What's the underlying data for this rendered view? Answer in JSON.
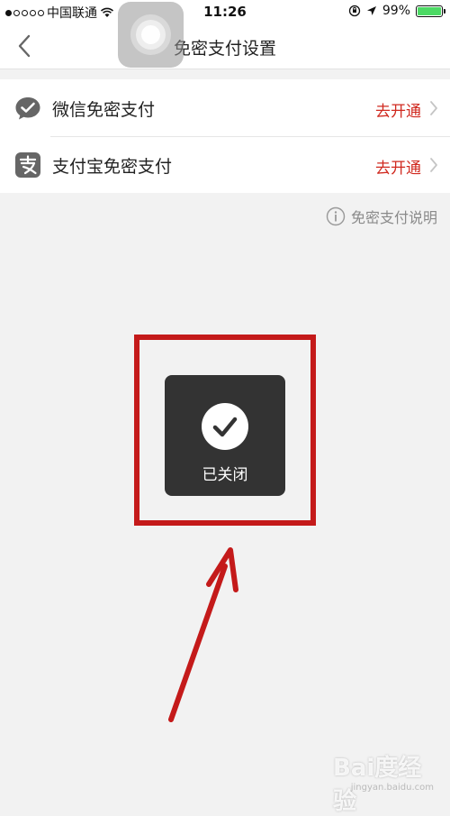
{
  "status_bar": {
    "carrier": "中国联通",
    "time": "11:26",
    "battery": "99%",
    "signal_bars_filled": 1,
    "signal_bars_total": 5,
    "battery_level": 0.99
  },
  "nav": {
    "title": "免密支付设置",
    "back_icon": "chevron-left-icon"
  },
  "payments": [
    {
      "label": "微信免密支付",
      "action": "去开通",
      "icon": "wechat-pay-icon"
    },
    {
      "label": "支付宝免密支付",
      "action": "去开通",
      "icon": "alipay-icon"
    }
  ],
  "help": {
    "text": "免密支付说明",
    "icon": "info-icon"
  },
  "toast": {
    "text": "已关闭",
    "icon": "check-circle-icon"
  },
  "watermark": {
    "brand": "Bai度经验",
    "url": "jingyan.baidu.com"
  },
  "colors": {
    "accent": "#d0291f",
    "annotation": "#c41a1a",
    "background": "#f2f2f2",
    "toast_bg": "#333333",
    "battery": "#4cd964"
  }
}
